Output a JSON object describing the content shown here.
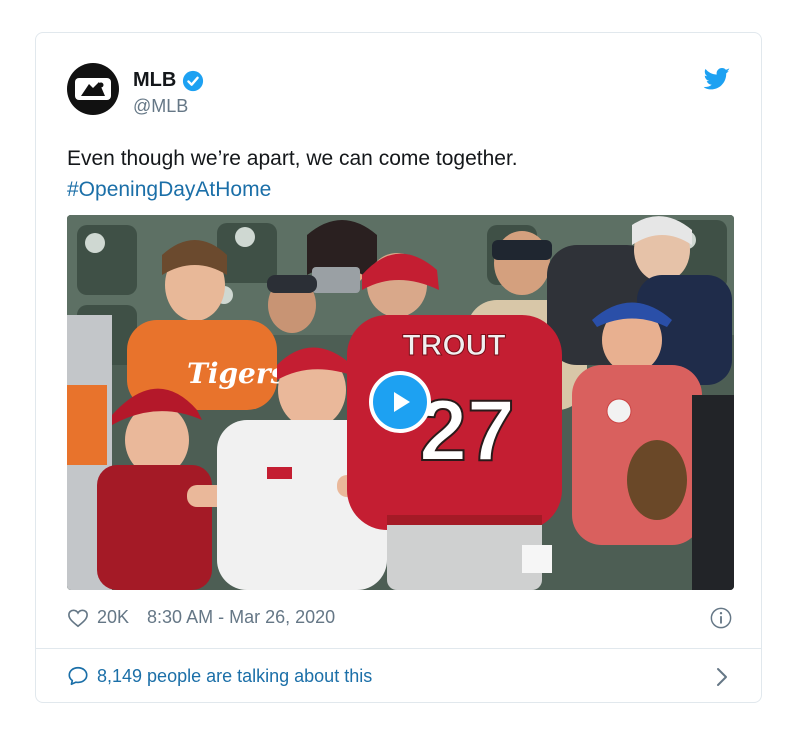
{
  "tweet": {
    "display_name": "MLB",
    "handle": "@MLB",
    "text": "Even though we’re apart, we can come together.",
    "hashtag": "#OpeningDayAtHome",
    "likes": "20K",
    "timestamp": "8:30 AM - Mar 26, 2020",
    "talking": "8,149 people are talking about this"
  },
  "media": {
    "jersey_name": "TROUT",
    "jersey_number": "27",
    "orange_shirt_text": "Tigers"
  },
  "colors": {
    "accent": "#1da1f2",
    "link": "#1b6fa8",
    "secondary_text": "#657786",
    "border": "#e1e8ed"
  },
  "icons": [
    "verified-badge-icon",
    "twitter-bird-icon",
    "heart-icon",
    "info-icon",
    "speech-bubble-icon",
    "chevron-right-icon",
    "play-icon"
  ]
}
